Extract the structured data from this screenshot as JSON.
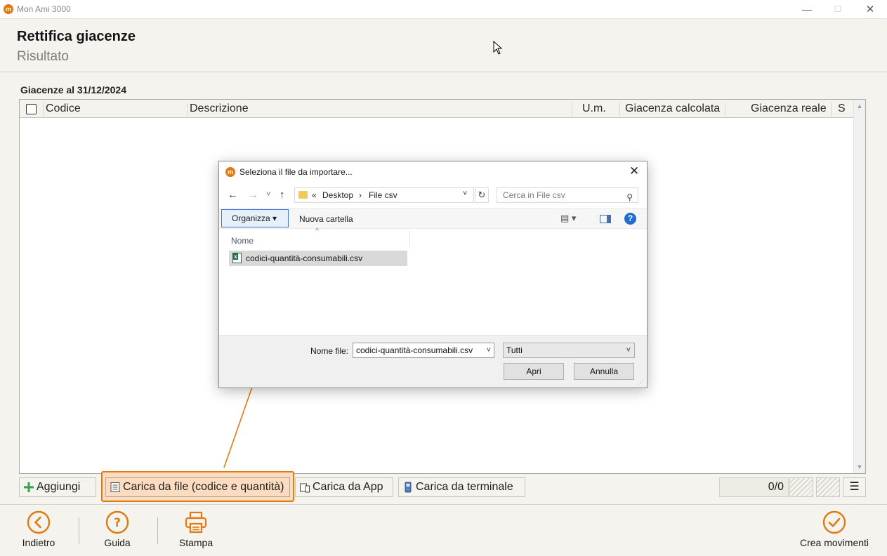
{
  "window": {
    "app_title": "Mon Ami 3000",
    "minimize": "—",
    "maximize": "☐",
    "close": "✕"
  },
  "header": {
    "title": "Rettifica giacenze",
    "subtitle": "Risultato"
  },
  "table": {
    "section_label": "Giacenze al 31/12/2024",
    "columns": [
      "Codice",
      "Descrizione",
      "U.m.",
      "Giacenza calcolata",
      "Giacenza reale",
      "S"
    ],
    "rows": []
  },
  "toolbar": {
    "add_label": "Aggiungi",
    "load_file_label": "Carica da file (codice e quantità)",
    "load_app_label": "Carica da App",
    "load_terminal_label": "Carica da terminale",
    "counter": "0/0",
    "menu_glyph": "☰"
  },
  "footer": {
    "back_label": "Indietro",
    "help_label": "Guida",
    "print_label": "Stampa",
    "create_label": "Crea movimenti"
  },
  "dialog": {
    "title": "Seleziona il file da importare...",
    "close": "✕",
    "nav": {
      "back": "←",
      "forward": "→",
      "recent": "˅",
      "up": "↑",
      "refresh": "↻"
    },
    "address": {
      "prefix": "«",
      "part1": "Desktop",
      "sep": "›",
      "part2": "File csv",
      "dropdown": "˅"
    },
    "search_placeholder": "Cerca in File csv",
    "search_icon": "⚲",
    "organize_label": "Organizza ▾",
    "new_folder_label": "Nuova cartella",
    "view_glyph": "▤ ▾",
    "help_glyph": "?",
    "column_name": "Nome",
    "sort_caret": "^",
    "files": [
      {
        "name": "codici-quantità-consumabili.csv"
      }
    ],
    "filename_label": "Nome file:",
    "filename_value": "codici-quantità-consumabili.csv",
    "filetype_value": "Tutti",
    "dropdown_glyph": "˅",
    "open_label": "Apri",
    "cancel_label": "Annulla"
  },
  "colors": {
    "accent": "#e07a10",
    "highlight_fill": "#fbdcc0",
    "dialog_focus": "#3b78d8"
  }
}
